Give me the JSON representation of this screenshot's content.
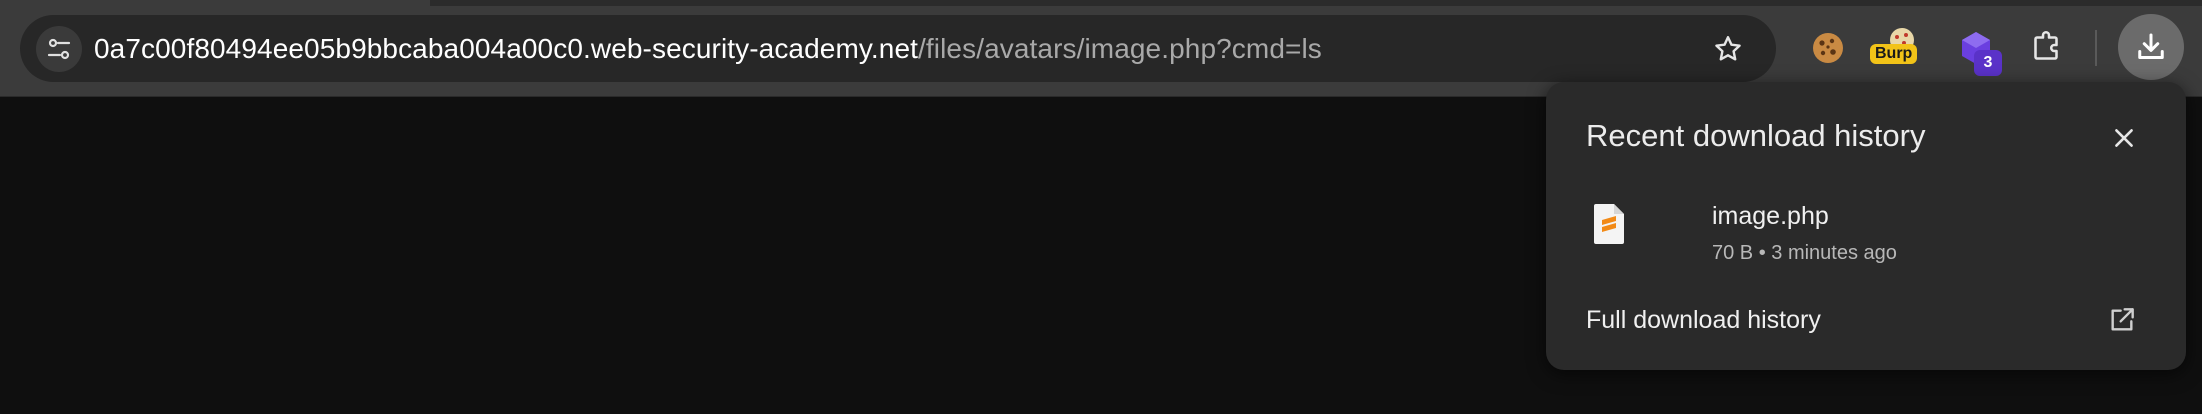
{
  "address_bar": {
    "host": "0a7c00f80494ee05b9bbcaba004a00c0.web-security-academy.net",
    "path": "/files/avatars/image.php?cmd=ls",
    "site_info_icon": "tune-icon",
    "bookmark_icon": "star-icon"
  },
  "extensions": [
    {
      "name": "cookie-extension",
      "icon": "cookie-icon"
    },
    {
      "name": "burp-extension",
      "icon": "burp-icon",
      "badge": "Burp"
    },
    {
      "name": "purple-extension",
      "icon": "purple-cube-icon",
      "badge": "3"
    },
    {
      "name": "extensions-menu",
      "icon": "puzzle-icon"
    }
  ],
  "download_button": {
    "icon": "download-icon"
  },
  "download_popup": {
    "title": "Recent download history",
    "close_icon": "close-icon",
    "items": [
      {
        "file_name": "image.php",
        "meta": "70 B • 3 minutes ago",
        "icon": "sublime-file-icon"
      }
    ],
    "full_history_label": "Full download history",
    "open_icon": "open-in-new-icon"
  },
  "colors": {
    "toolbar": "#3b3b3b",
    "omnibox": "#272727",
    "page_background": "#0f0f0f",
    "popup": "#2a2a2a",
    "burp_badge": "#f2c318",
    "count_badge": "#5a32c8",
    "file_accent": "#f28a17"
  }
}
